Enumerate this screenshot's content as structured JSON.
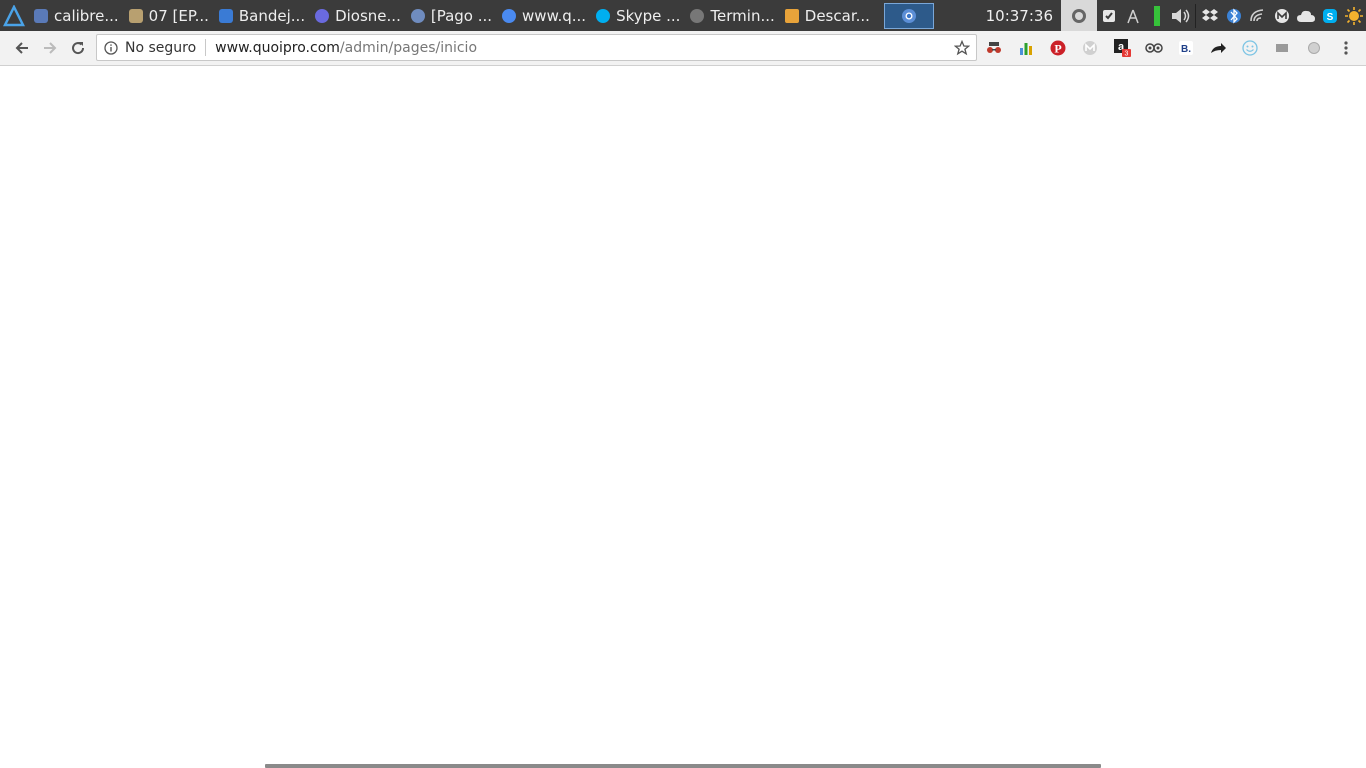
{
  "taskbar": {
    "tasks": [
      {
        "label": "calibre...",
        "color": "#5a7ab8"
      },
      {
        "label": "07 [EP...",
        "color": "#b8a070"
      },
      {
        "label": "Bandej...",
        "color": "#3a7bd5"
      },
      {
        "label": "Diosne...",
        "color": "#6a6adf"
      },
      {
        "label": "[Pago ...",
        "color": "#6f8cbf"
      },
      {
        "label": "www.q...",
        "color": "#4a8af0"
      },
      {
        "label": "Skype ...",
        "color": "#00aff0"
      },
      {
        "label": "Termin...",
        "color": "#777777"
      },
      {
        "label": "Descar...",
        "color": "#e8a33a"
      }
    ],
    "clock": "10:37:36"
  },
  "browser": {
    "security_label": "No seguro",
    "url_host": "www.quoipro.com",
    "url_path": "/admin/pages/inicio",
    "extension_badge": "3"
  }
}
